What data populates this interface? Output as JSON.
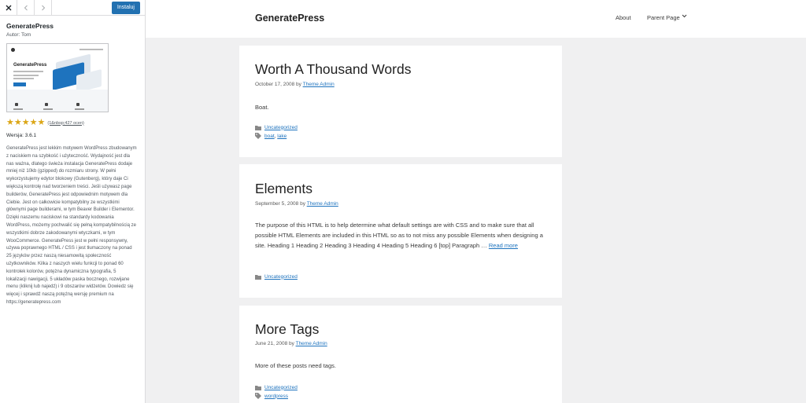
{
  "sidebar": {
    "install_label": "Instaluj",
    "theme_name": "GeneratePress",
    "author": "Autor: Tom",
    "screenshot_title": "GeneratePress",
    "rating_stars": 5,
    "rating_count": "(1&nbsp;427 ocen)",
    "version": "Wersja: 3.6.1",
    "description": "GeneratePress jest lekkim motywem WordPress zbudowanym z naciskiem na szybkość i użyteczność. Wydajność jest dla nas ważna, dlatego świeża instalacja GeneratePress dodaje mniej niż 10kb (gzipped) do rozmiaru strony. W pełni wykorzystujemy edytor blokowy (Gutenberg), który daje Ci większą kontrolę nad tworzeniem treści. Jeśli używasz page builderów, GeneratePress jest odpowiednim motywem dla Ciebie. Jest on całkowicie kompatybilny ze wszystkimi głównymi page builderami, w tym Beaver Builder i Elementor. Dzięki naszemu naciskowi na standardy kodowania WordPress, możemy pochwalić się pełną kompatybilnością ze wszystkimi dobrze zakodowanymi wtyczkami, w tym WooCommerce. GeneratePress jest w pełni responsywny, używa poprawnego HTML / CSS i jest tłumaczony na ponad 25 języków przez naszą niesamowitą społeczność użytkowników. Kilka z naszych wielu funkcji to ponad 60 kontrolek kolorów, potężna dynamiczna typografia, 5 lokalizacji nawigacji, 5 układów paska bocznego, rozwijane menu (kliknij lub najedź) i 9 obszarów widżetów. Dowiedz się więcej i sprawdź naszą potężną wersję premium na https://generatepress.com"
  },
  "site": {
    "title": "GeneratePress",
    "nav": {
      "about": "About",
      "parent_page": "Parent Page"
    }
  },
  "posts": [
    {
      "title": "Worth A Thousand Words",
      "date": "October 17, 2008",
      "by": "by",
      "author": "Theme Admin",
      "excerpt": "Boat.",
      "category": "Uncategorized",
      "tags": [
        "boat",
        "lake"
      ]
    },
    {
      "title": "Elements",
      "date": "September 5, 2008",
      "by": "by",
      "author": "Theme Admin",
      "excerpt": "The purpose of this HTML is to help determine what default settings are with CSS and to make sure that all possible HTML Elements are included in this HTML so as to not miss any possible Elements when designing a site. Heading 1 Heading 2 Heading 3 Heading 4 Heading 5 Heading 6 [top] Paragraph … ",
      "read_more": "Read more",
      "category": "Uncategorized"
    },
    {
      "title": "More Tags",
      "date": "June 21, 2008",
      "by": "by",
      "author": "Theme Admin",
      "excerpt": "More of these posts need tags.",
      "category": "Uncategorized",
      "tags": [
        "wordpress"
      ]
    }
  ],
  "colors": {
    "accent": "#1e73be",
    "install_button": "#2271b1",
    "star": "#dba617"
  }
}
